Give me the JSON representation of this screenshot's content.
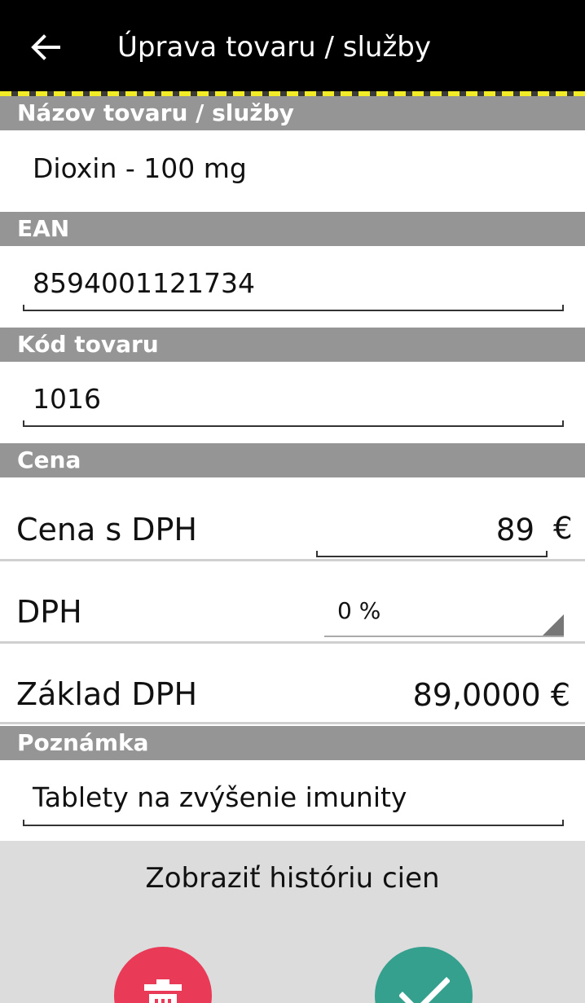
{
  "header": {
    "title": "Úprava tovaru / služby",
    "back_icon": "arrow-left-icon"
  },
  "sections": {
    "name_header": "Názov tovaru / služby",
    "ean_header": "EAN",
    "code_header": "Kód tovaru",
    "price_header": "Cena",
    "note_header": "Poznámka"
  },
  "fields": {
    "name_value": "Dioxin - 100 mg",
    "ean_value": "8594001121734",
    "code_value": "1016",
    "note_value": "Tablety na zvýšenie imunity"
  },
  "price": {
    "price_label": "Cena s DPH",
    "price_value": "89",
    "currency": "€",
    "vat_label": "DPH",
    "vat_selected": "0 %",
    "base_label": "Základ DPH",
    "base_value": "89,0000 €"
  },
  "actions": {
    "history_label": "Zobraziť históriu cien",
    "delete_icon": "trash-icon",
    "confirm_icon": "checkmark-icon"
  },
  "colors": {
    "header_bg": "#000000",
    "hazard_yellow": "#f2ec27",
    "section_bg": "#959595",
    "panel_bg": "#dcdcdc",
    "delete": "#e93a57",
    "confirm": "#36a08e"
  }
}
